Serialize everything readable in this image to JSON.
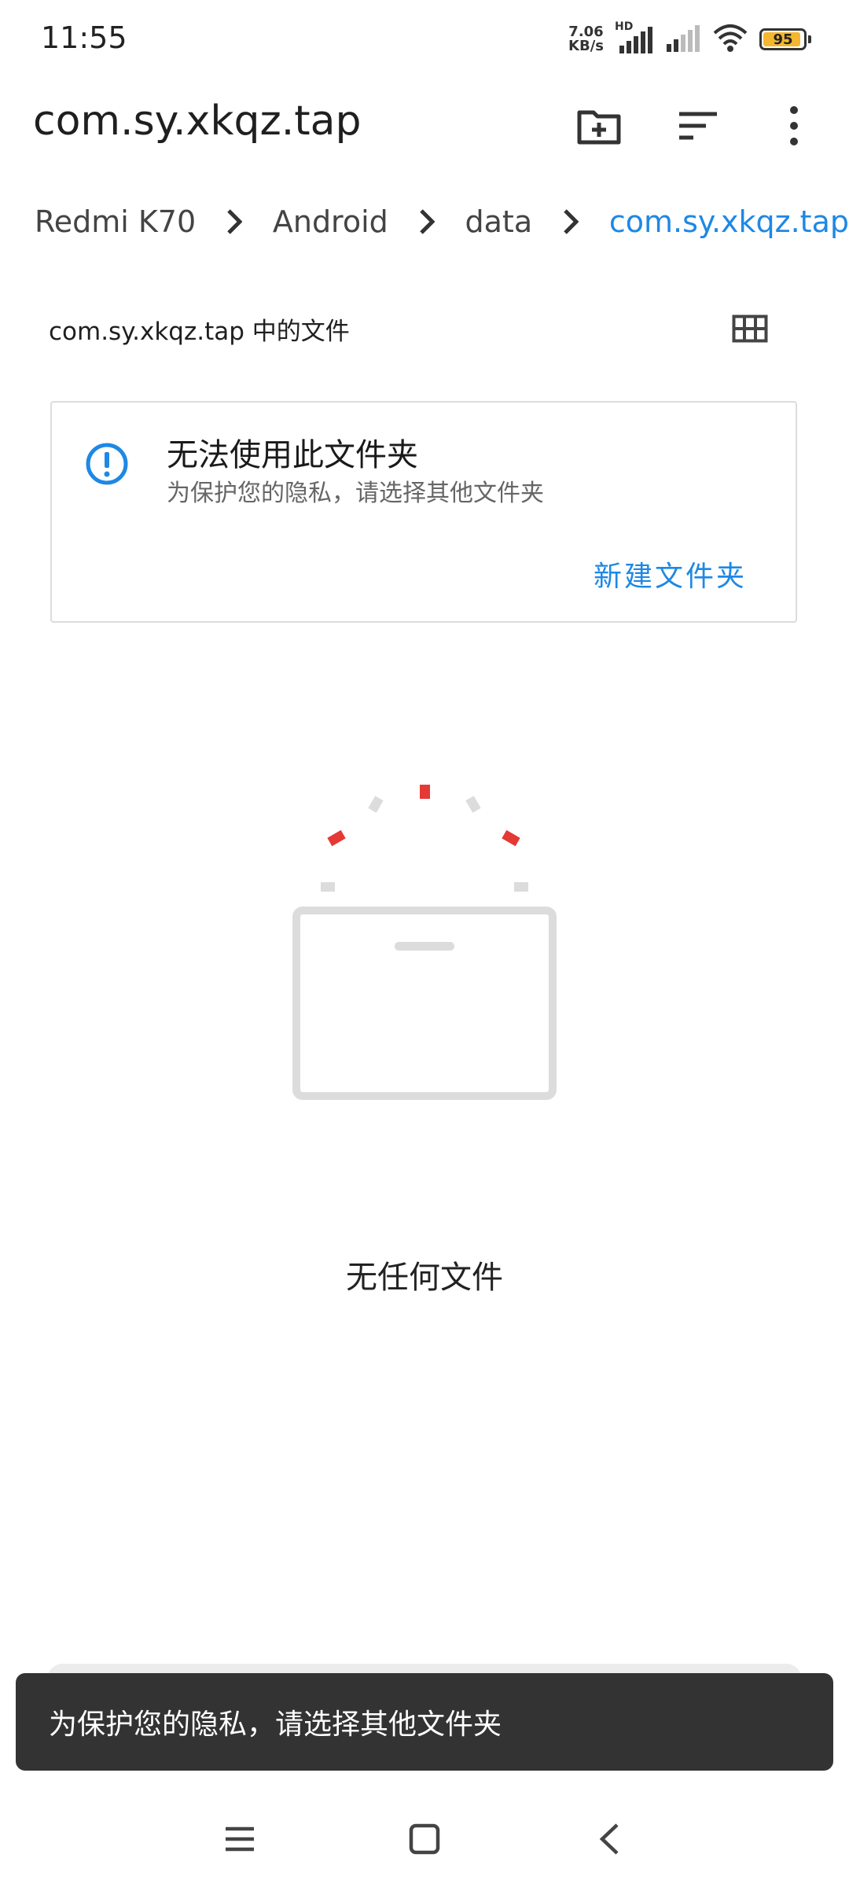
{
  "status_bar": {
    "time": "11:55",
    "net_speed_value": "7.06",
    "net_speed_unit": "KB/s",
    "network_type": "HD",
    "battery_level": 95,
    "battery_text": "95",
    "battery_color": "#f5b730"
  },
  "app_bar": {
    "title": "com.sy.xkqz.tap",
    "actions": [
      "new-folder-icon",
      "sort-icon",
      "more-vert-icon"
    ]
  },
  "breadcrumb": {
    "items": [
      "Redmi K70",
      "Android",
      "data",
      "com.sy.xkqz.tap"
    ],
    "active_color": "#1e88e5"
  },
  "section": {
    "header": "com.sy.xkqz.tap 中的文件",
    "view_toggle": "grid-view-icon"
  },
  "info_card": {
    "title": "无法使用此文件夹",
    "subtitle": "为保护您的隐私，请选择其他文件夹",
    "action_label": "新建文件夹",
    "icon": "info-alert-icon"
  },
  "empty_state": {
    "text": "无任何文件",
    "icon": "empty-box-icon"
  },
  "snackbar": {
    "text": "为保护您的隐私，请选择其他文件夹"
  },
  "nav_bar": {
    "buttons": [
      "menu-icon",
      "home-icon",
      "back-icon"
    ]
  }
}
